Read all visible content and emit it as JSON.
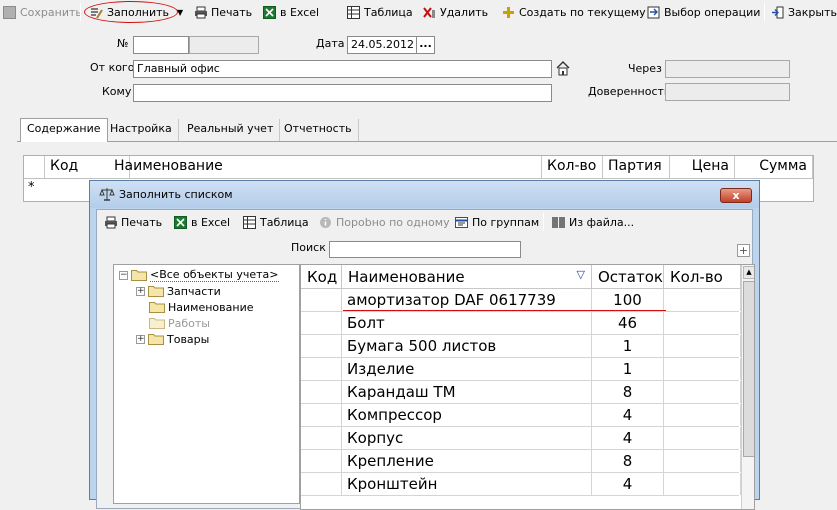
{
  "toolbar": {
    "save": "Сохранить",
    "fill": "Заполнить",
    "print": "Печать",
    "excel": "в Excel",
    "table": "Таблица",
    "delete": "Удалить",
    "create_by_current": "Создать по текущему",
    "select_operation": "Выбор операции",
    "close": "Закрыть"
  },
  "form": {
    "number_label": "№",
    "number_value": "",
    "date_label": "Дата",
    "date_value": "24.05.2012",
    "date_button": "...",
    "from_label": "От кого",
    "from_value": "Главный офис",
    "to_label": "Кому",
    "to_value": "",
    "via_label": "Через",
    "via_value": "",
    "proxy_label": "Доверенность",
    "proxy_value": ""
  },
  "tabs": [
    "Содержание",
    "Настройка",
    "Реальный учет",
    "Отчетность"
  ],
  "main_grid": {
    "columns": [
      "Код",
      "Наименование",
      "Кол-во",
      "Партия",
      "Цена",
      "Сумма"
    ],
    "new_row_marker": "*"
  },
  "dialog": {
    "title": "Заполнить списком",
    "close": "x",
    "toolbar": {
      "print": "Печать",
      "excel": "в Excel",
      "table": "Таблица",
      "detail_one": "Порobно по одному",
      "by_groups": "По группам",
      "from_file": "Из файла..."
    },
    "search_label": "Поиск",
    "search_value": "",
    "plus_button": "+",
    "tree": [
      {
        "label": "<Все объекты учета>",
        "expander": "−",
        "disabled": false
      },
      {
        "label": "Запчасти",
        "expander": "+",
        "disabled": false
      },
      {
        "label": "Наименование",
        "expander": "",
        "disabled": false
      },
      {
        "label": "Работы",
        "expander": "",
        "disabled": true
      },
      {
        "label": "Товары",
        "expander": "+",
        "disabled": false
      }
    ],
    "list_columns": [
      "Код",
      "Наименование",
      "Остаток",
      "Кол-во"
    ],
    "sort_icon": "▽",
    "rows": [
      {
        "code": "",
        "name": "амортизатор DAF 0617739",
        "stock": "100",
        "qty": ""
      },
      {
        "code": "",
        "name": "Болт",
        "stock": "46",
        "qty": ""
      },
      {
        "code": "",
        "name": "Бумага 500 листов",
        "stock": "1",
        "qty": ""
      },
      {
        "code": "",
        "name": "Изделие",
        "stock": "1",
        "qty": ""
      },
      {
        "code": "",
        "name": "Карандаш ТМ",
        "stock": "8",
        "qty": ""
      },
      {
        "code": "",
        "name": "Компрессор",
        "stock": "4",
        "qty": ""
      },
      {
        "code": "",
        "name": "Корпус",
        "stock": "4",
        "qty": ""
      },
      {
        "code": "",
        "name": "Крепление",
        "stock": "8",
        "qty": ""
      },
      {
        "code": "",
        "name": "Кронштейн",
        "stock": "4",
        "qty": ""
      }
    ]
  },
  "colors": {
    "dialog_title_bg": "#c4d8ef",
    "close_button": "#c4402a",
    "highlight_line": "#d01010",
    "excel_green": "#1e7a30"
  }
}
